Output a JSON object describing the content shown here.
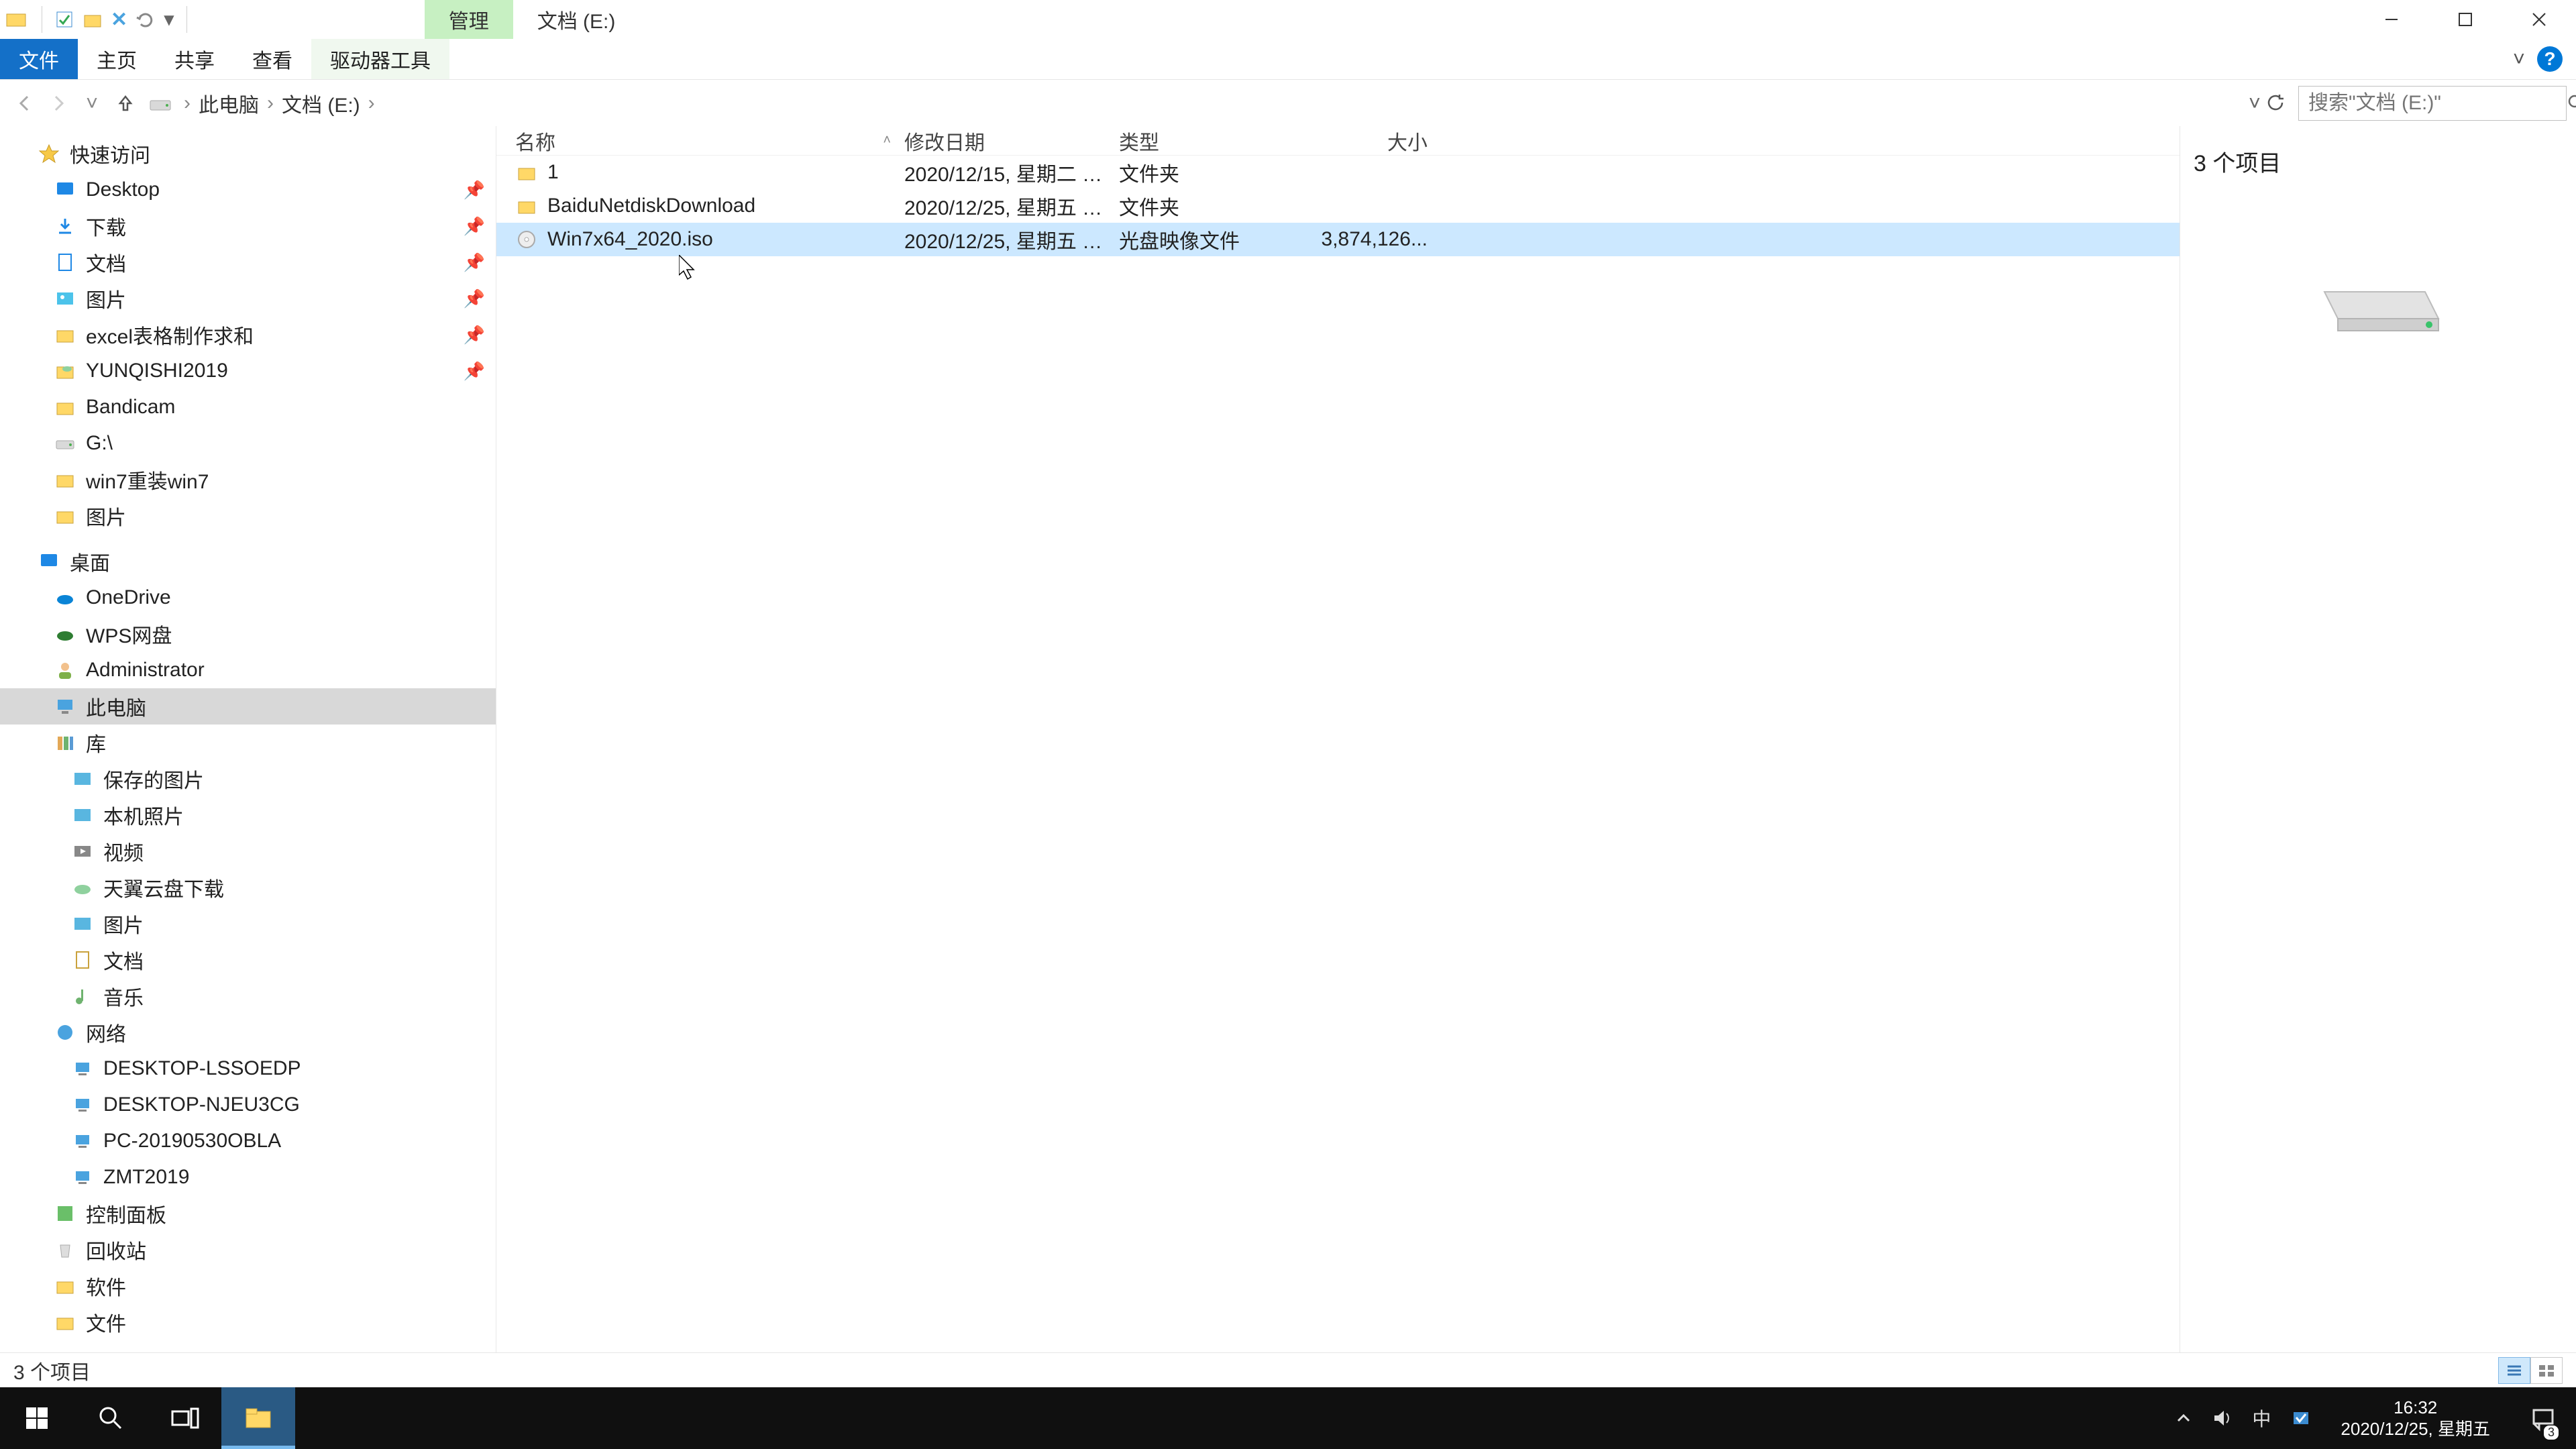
{
  "titlebar": {
    "context_tab": "管理",
    "location_label": "文档 (E:)"
  },
  "ribbon": {
    "file": "文件",
    "home": "主页",
    "share": "共享",
    "view": "查看",
    "drive_tools": "驱动器工具"
  },
  "breadcrumbs": {
    "root": "此电脑",
    "current": "文档 (E:)"
  },
  "search": {
    "placeholder": "搜索\"文档 (E:)\""
  },
  "sidebar": {
    "quick_access": "快速访问",
    "qa_items": [
      {
        "label": "Desktop",
        "pin": true,
        "icon": "desktop"
      },
      {
        "label": "下载",
        "pin": true,
        "icon": "downloads"
      },
      {
        "label": "文档",
        "pin": true,
        "icon": "documents"
      },
      {
        "label": "图片",
        "pin": true,
        "icon": "pictures"
      },
      {
        "label": "excel表格制作求和",
        "pin": true,
        "icon": "folder"
      },
      {
        "label": "YUNQISHI2019",
        "pin": true,
        "icon": "folder-cloud"
      },
      {
        "label": "Bandicam",
        "pin": false,
        "icon": "folder"
      },
      {
        "label": "G:\\",
        "pin": false,
        "icon": "drive"
      },
      {
        "label": "win7重装win7",
        "pin": false,
        "icon": "folder"
      },
      {
        "label": "图片",
        "pin": false,
        "icon": "folder"
      }
    ],
    "desktop_section": "桌面",
    "desktop_items": [
      {
        "label": "OneDrive",
        "icon": "onedrive"
      },
      {
        "label": "WPS网盘",
        "icon": "wps"
      },
      {
        "label": "Administrator",
        "icon": "user"
      },
      {
        "label": "此电脑",
        "icon": "thispc",
        "selected": true
      },
      {
        "label": "库",
        "icon": "libraries"
      }
    ],
    "library_items": [
      {
        "label": "保存的图片",
        "icon": "piclib"
      },
      {
        "label": "本机照片",
        "icon": "piclib"
      },
      {
        "label": "视频",
        "icon": "video"
      },
      {
        "label": "天翼云盘下载",
        "icon": "cloud"
      },
      {
        "label": "图片",
        "icon": "piclib"
      },
      {
        "label": "文档",
        "icon": "doclib"
      },
      {
        "label": "音乐",
        "icon": "music"
      }
    ],
    "network": "网络",
    "network_items": [
      {
        "label": "DESKTOP-LSSOEDP"
      },
      {
        "label": "DESKTOP-NJEU3CG"
      },
      {
        "label": "PC-20190530OBLA"
      },
      {
        "label": "ZMT2019"
      }
    ],
    "control_panel": "控制面板",
    "recycle_bin": "回收站",
    "software": "软件",
    "docs_folder": "文件"
  },
  "columns": {
    "name": "名称",
    "date": "修改日期",
    "type": "类型",
    "size": "大小"
  },
  "rows": [
    {
      "name": "1",
      "date": "2020/12/15, 星期二 1...",
      "type": "文件夹",
      "size": "",
      "icon": "folder",
      "selected": false
    },
    {
      "name": "BaiduNetdiskDownload",
      "date": "2020/12/25, 星期五 1...",
      "type": "文件夹",
      "size": "",
      "icon": "folder",
      "selected": false
    },
    {
      "name": "Win7x64_2020.iso",
      "date": "2020/12/25, 星期五 1...",
      "type": "光盘映像文件",
      "size": "3,874,126...",
      "icon": "iso",
      "selected": true
    }
  ],
  "preview": {
    "item_count": "3 个项目"
  },
  "statusbar": {
    "text": "3 个项目"
  },
  "taskbar": {
    "time": "16:32",
    "date": "2020/12/25, 星期五",
    "lang": "中",
    "notif_badge": "3"
  }
}
